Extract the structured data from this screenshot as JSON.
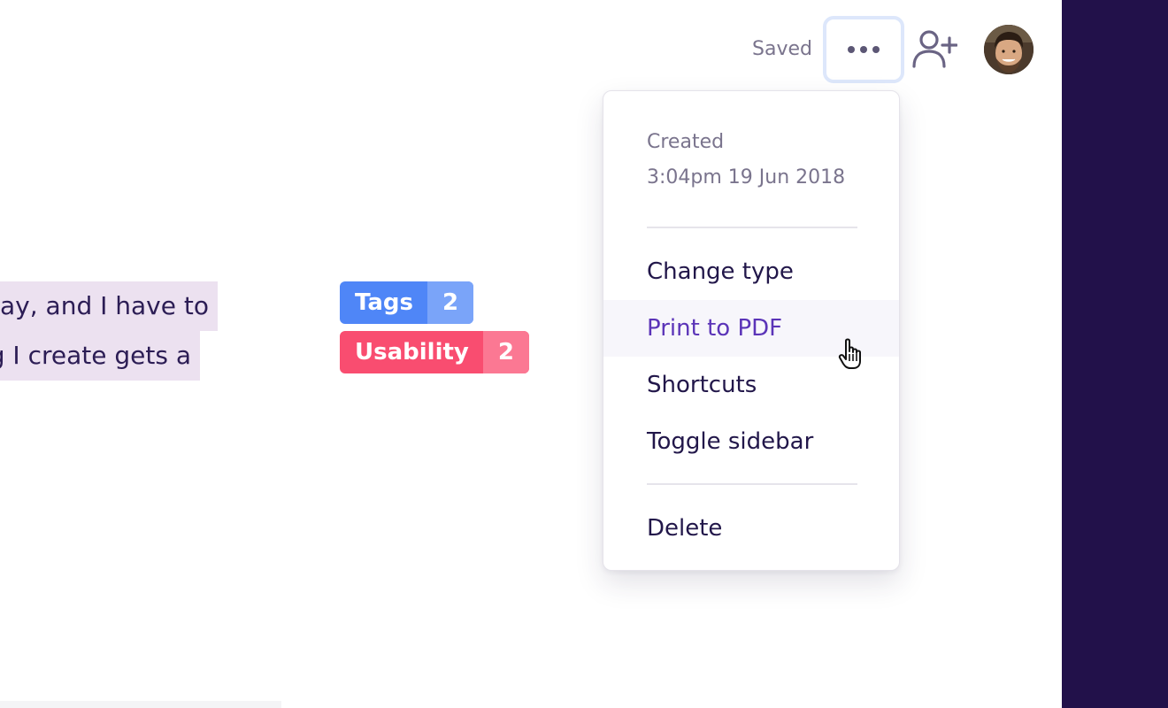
{
  "header": {
    "status": "Saved",
    "more_icon": "ellipsis-icon",
    "add_user_icon": "add-user-icon",
    "avatar_icon": "user-avatar"
  },
  "editor": {
    "highlighted_lines": [
      "ray, and I have to",
      "g I create gets a"
    ],
    "highlight_color": "#ece1f0"
  },
  "tags": [
    {
      "label": "Tags",
      "count": "2",
      "color": "#4f86f7"
    },
    {
      "label": "Usability",
      "count": "2",
      "color": "#f94d70"
    }
  ],
  "menu": {
    "created_label": "Created",
    "created_date": "3:04pm 19 Jun 2018",
    "items": [
      {
        "label": "Change type"
      },
      {
        "label": "Print to PDF",
        "hovered": true
      },
      {
        "label": "Shortcuts"
      },
      {
        "label": "Toggle sidebar"
      },
      {
        "label": "Delete"
      }
    ]
  },
  "colors": {
    "sidebar": "#22114a",
    "menu_hover_text": "#5b34b8",
    "text_primary": "#22174a",
    "text_muted": "#7a748d"
  }
}
